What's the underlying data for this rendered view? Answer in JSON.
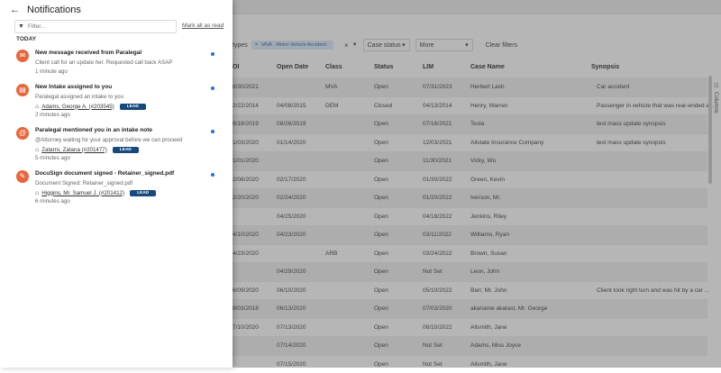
{
  "background": {
    "filters": {
      "type_label": "types",
      "chip_label": "MVA · Motor Vehicle Accident",
      "case_status_label": "Case status",
      "more_label": "More",
      "clear_label": "Clear filters"
    },
    "columns_tab_label": "Columns",
    "table": {
      "headers": [
        "OI",
        "Open Date",
        "Class",
        "Status",
        "LIM",
        "Case Name",
        "Synopsis"
      ],
      "rows": [
        [
          "8/30/2021",
          "",
          "MVA",
          "Open",
          "07/31/2023",
          "Herbert Lash",
          "Car accident"
        ],
        [
          "2/22/2014",
          "04/08/2015",
          "DEM",
          "Closed",
          "04/13/2014",
          "Henry, Warren",
          "Passenger in vehicle that was rear-ended a..."
        ],
        [
          "8/18/2019",
          "08/26/2019",
          "",
          "Open",
          "07/16/2021",
          "Tesla",
          "test mass update synopsis"
        ],
        [
          "1/03/2020",
          "01/14/2020",
          "",
          "Open",
          "12/03/2021",
          "Allstate Insurance Company",
          "test mass update synopsis"
        ],
        [
          "1/01/2020",
          "",
          "",
          "Open",
          "11/30/2021",
          "Vicky, Wu",
          ""
        ],
        [
          "2/08/2020",
          "02/17/2020",
          "",
          "Open",
          "01/30/2022",
          "Green, Kevin",
          ""
        ],
        [
          "2/20/2020",
          "02/24/2020",
          "",
          "Open",
          "01/20/2022",
          "Iverson, Mr.",
          ""
        ],
        [
          "",
          "04/25/2020",
          "",
          "Open",
          "04/18/2022",
          "Jenkins, Riley",
          ""
        ],
        [
          "4/10/2020",
          "04/23/2020",
          "",
          "Open",
          "03/11/2022",
          "Williams, Ryan",
          ""
        ],
        [
          "4/23/2020",
          "",
          "ARB",
          "Open",
          "03/24/2022",
          "Brown, Susan",
          ""
        ],
        [
          "",
          "04/29/2020",
          "",
          "Open",
          "Not Set",
          "Leon, John",
          ""
        ],
        [
          "6/09/2020",
          "06/10/2020",
          "",
          "Open",
          "05/10/2022",
          "Barr, Mr. John",
          "Client took right turn and was hit by a car ..."
        ],
        [
          "8/03/2018",
          "06/13/2020",
          "",
          "Open",
          "07/03/2020",
          "akaname akalast, Mr. George",
          ""
        ],
        [
          "7/10/2020",
          "07/13/2020",
          "",
          "Open",
          "06/10/2022",
          "Allsmith, Jane",
          ""
        ],
        [
          "",
          "07/14/2020",
          "",
          "Open",
          "Not Set",
          "Adams, Miss Joyce",
          ""
        ],
        [
          "",
          "07/15/2020",
          "",
          "Open",
          "Not Set",
          "Allsmith, Jane",
          ""
        ]
      ]
    }
  },
  "panel": {
    "title": "Notifications",
    "filter_placeholder": "Filter...",
    "mark_all_label": "Mark all as read",
    "section_label": "TODAY",
    "notifications": [
      {
        "title": "New message received from Paralegal",
        "body": "Client call for an update her. Requested call back ASAP",
        "time": "1 minute ago"
      },
      {
        "title": "New Intake assigned to you",
        "body": "Paralegal assigned an intake to you",
        "case": "Adams, George A. (#203545)",
        "badge": "LEAD",
        "time": "2 minutes ago"
      },
      {
        "title": "Paralegal mentioned you in an intake note",
        "body": "@Attorney waiting for your approval before we can proceed",
        "case": "Zatarro, Zatana (#201477)",
        "badge": "LEAD",
        "time": "5 minutes ago"
      },
      {
        "title": "DocuSign document signed - Retainer_signed.pdf",
        "body": "Document Signed: Retainer_signed.pdf",
        "case": "Higgins, Mr. Samuel J. (#201412)",
        "badge": "LEAD",
        "time": "6 minutes ago"
      }
    ]
  },
  "colors": {
    "accent_icon": "#e9663b",
    "unread_dot": "#2a6de0",
    "lead_badge": "#164a7a",
    "chip_bg": "#dbe9f8"
  }
}
